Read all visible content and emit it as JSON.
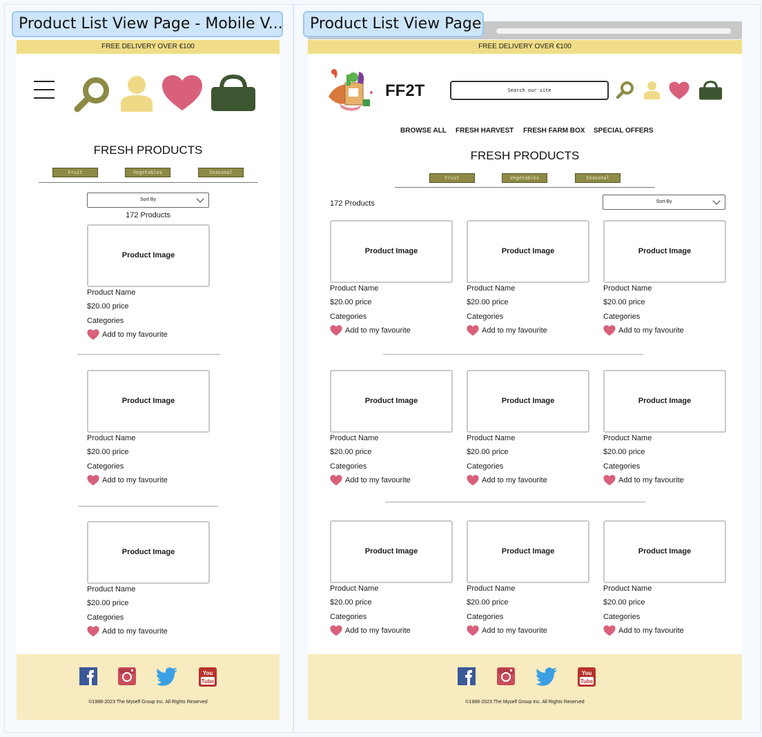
{
  "labels": {
    "mobile": "Product List View Page - Mobile V...",
    "desktop": "Product List View Page"
  },
  "delivery_banner": "FREE DELIVERY OVER €100",
  "brand": "FF2T",
  "search_placeholder": "Search our site",
  "nav": [
    "BROWSE ALL",
    "FRESH HARVEST",
    "FRESH FARM BOX",
    "SPECIAL OFFERS"
  ],
  "section_title": "FRESH PRODUCTS",
  "filters": [
    "Fruit",
    "Vegetables",
    "Seasonal"
  ],
  "sort_label": "Sort By",
  "product_count": "172 Products",
  "product": {
    "image_label": "Product Image",
    "name": "Product Name",
    "price": "$20.00 price",
    "categories": "Categories",
    "favourite": "Add to my favourite"
  },
  "footer_copyright": "©1988-2023 The Myself Group Inc. All Rights Reserved",
  "social": [
    "facebook-icon",
    "instagram-icon",
    "twitter-icon",
    "youtube-icon"
  ],
  "colors": {
    "banner": "#f1dd88",
    "footer": "#f8ebbf",
    "chip": "#8c8a45",
    "heart": "#d8607a",
    "bag": "#3e5532",
    "user": "#f0d986",
    "search": "#8c8a45"
  }
}
